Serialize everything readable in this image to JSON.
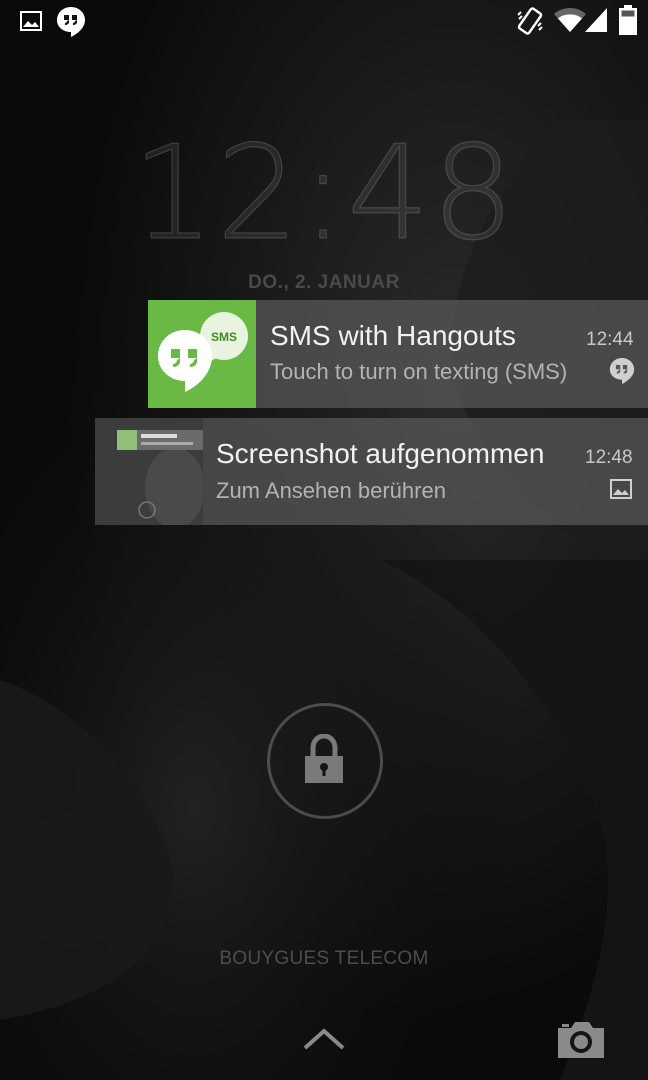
{
  "status_bar": {
    "icons": [
      "gallery-icon",
      "hangouts-icon",
      "vibrate-icon",
      "wifi-icon",
      "signal-icon",
      "battery-icon"
    ]
  },
  "lockscreen": {
    "time": "12:48",
    "date": "DO., 2. JANUAR",
    "carrier": "BOUYGUES TELECOM"
  },
  "notifications": [
    {
      "title": "SMS with Hangouts",
      "text": "Touch to turn on texting (SMS)",
      "time": "12:44",
      "icon_badge": "SMS",
      "accent": "#6ab945",
      "small_icon": "hangouts-icon"
    },
    {
      "title": "Screenshot aufgenommen",
      "text": "Zum Ansehen berühren",
      "time": "12:48",
      "small_icon": "gallery-icon"
    }
  ],
  "bottom": {
    "icons": [
      "chevron-up-icon",
      "camera-icon"
    ]
  }
}
